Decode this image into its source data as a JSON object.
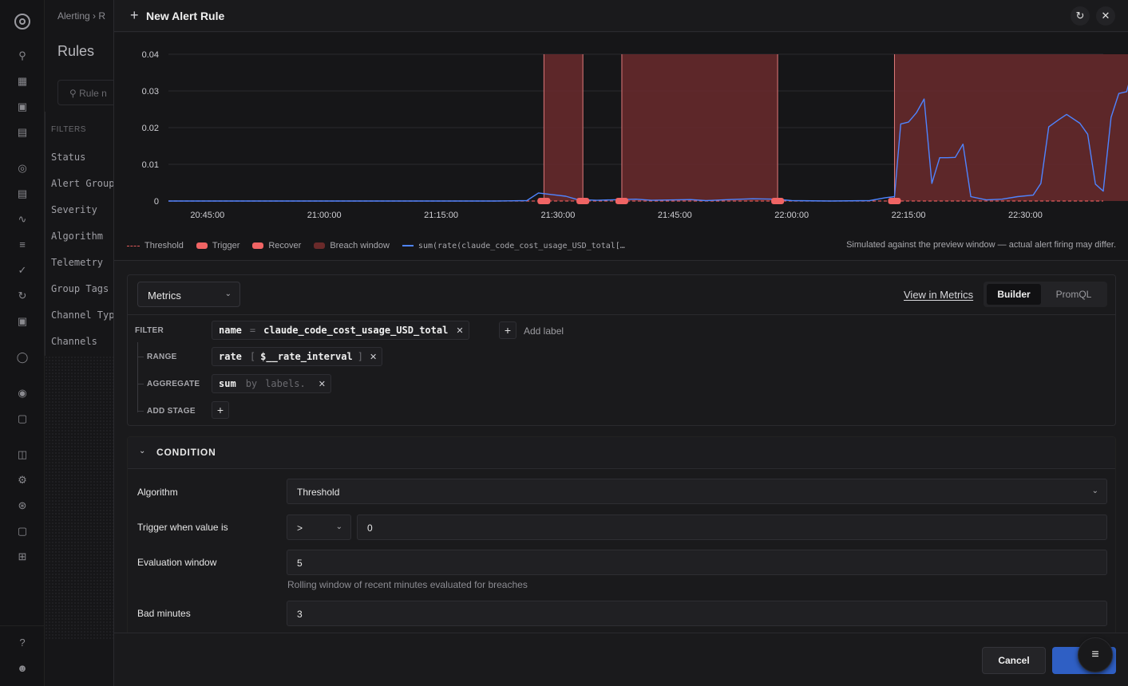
{
  "modal": {
    "title": "New Alert Rule",
    "header_plus": "+",
    "refresh_icon": "refresh-icon",
    "close_icon": "close-icon"
  },
  "background_page": {
    "breadcrumb": "Alerting",
    "title": "Rules",
    "search_placeholder": "Rule n",
    "filters_label": "FILTERS",
    "filters": [
      "Status",
      "Alert Group",
      "Severity",
      "Algorithm",
      "Telemetry",
      "Group Tags",
      "Channel Typ",
      "Channels"
    ]
  },
  "chart_data": {
    "type": "line",
    "title": "",
    "xlabel": "",
    "ylabel": "",
    "x_ticks": [
      "20:45:00",
      "21:00:00",
      "21:15:00",
      "21:30:00",
      "21:45:00",
      "22:00:00",
      "22:15:00",
      "22:30:00"
    ],
    "y_ticks": [
      "0",
      "0.01",
      "0.02",
      "0.03",
      "0.04"
    ],
    "ylim": [
      0,
      0.04
    ],
    "xlim_minutes_after_2030": [
      10,
      130
    ],
    "threshold": 0,
    "breach_windows": [
      [
        58.2,
        63.2
      ],
      [
        68.2,
        88.2
      ],
      [
        103.2,
        137.2
      ]
    ],
    "trigger_markers": [
      58.2,
      68.2,
      103.2
    ],
    "recover_markers": [
      63.2,
      88.2
    ],
    "series": [
      {
        "name": "sum(rate(claude_code_cost_usage_USD_total[…",
        "color": "#4f84ff",
        "points": [
          [
            10,
            0
          ],
          [
            45,
            0
          ],
          [
            52,
            0
          ],
          [
            56,
            0.0001
          ],
          [
            57.5,
            0.0022
          ],
          [
            59,
            0.0018
          ],
          [
            61,
            0.0013
          ],
          [
            62.5,
            0.0004
          ],
          [
            65,
            0.0002
          ],
          [
            68,
            0.0004
          ],
          [
            70,
            0.0005
          ],
          [
            72,
            0.0002
          ],
          [
            75,
            0.0003
          ],
          [
            77,
            0.0004
          ],
          [
            79,
            0.0001
          ],
          [
            82,
            0.0004
          ],
          [
            85,
            0.0006
          ],
          [
            88,
            0.0005
          ],
          [
            90,
            0.0001
          ],
          [
            95,
            0
          ],
          [
            100,
            0.0001
          ],
          [
            102,
            0.0009
          ],
          [
            103.2,
            0.0012
          ],
          [
            104,
            0.021
          ],
          [
            105,
            0.0215
          ],
          [
            106,
            0.024
          ],
          [
            107,
            0.0278
          ],
          [
            108,
            0.0048
          ],
          [
            109,
            0.0118
          ],
          [
            110,
            0.0118
          ],
          [
            111,
            0.0119
          ],
          [
            112,
            0.0155
          ],
          [
            113,
            0.0012
          ],
          [
            115,
            0.0003
          ],
          [
            117,
            0.0005
          ],
          [
            119,
            0.0012
          ],
          [
            121,
            0.0016
          ],
          [
            122,
            0.0048
          ],
          [
            123,
            0.0202
          ],
          [
            124.3,
            0.0222
          ],
          [
            125.3,
            0.0236
          ],
          [
            127,
            0.0212
          ],
          [
            128,
            0.0182
          ],
          [
            129,
            0.0046
          ],
          [
            130,
            0.0027
          ],
          [
            131,
            0.0228
          ],
          [
            132,
            0.0293
          ],
          [
            133,
            0.0298
          ],
          [
            134,
            0.0376
          ],
          [
            135,
            0.0285
          ],
          [
            136,
            0.0025
          ],
          [
            137,
            0.0003
          ],
          [
            138,
            0.0001
          ],
          [
            140,
            0
          ]
        ]
      }
    ]
  },
  "legend": {
    "threshold": "Threshold",
    "trigger": "Trigger",
    "recover": "Recover",
    "breach_window": "Breach window",
    "series": "sum(rate(claude_code_cost_usage_USD_total[…"
  },
  "simulation_note": "Simulated against the preview window — actual alert firing may differ.",
  "query": {
    "datasource": "Metrics",
    "view_in_metrics": "View in Metrics",
    "mode_builder": "Builder",
    "mode_promql": "PromQL",
    "filter_label": "FILTER",
    "filter_key": "name",
    "filter_op": "=",
    "filter_value": "claude_code_cost_usage_USD_total",
    "add_label": "Add label",
    "range_label": "RANGE",
    "range_fn": "rate",
    "range_open": "[",
    "range_value": "$__rate_interval",
    "range_close": "]",
    "aggregate_label": "AGGREGATE",
    "aggregate_fn": "sum",
    "aggregate_by": "by",
    "aggregate_labels_placeholder": "labels.",
    "add_stage_label": "ADD STAGE"
  },
  "condition": {
    "header": "CONDITION",
    "algorithm_label": "Algorithm",
    "algorithm_value": "Threshold",
    "trigger_label": "Trigger when value is",
    "trigger_operator": ">",
    "trigger_value": "0",
    "eval_window_label": "Evaluation window",
    "eval_window_value": "5",
    "eval_window_hint": "Rolling window of recent minutes evaluated for breaches",
    "bad_minutes_label": "Bad minutes",
    "bad_minutes_value": "3"
  },
  "footer": {
    "cancel": "Cancel",
    "create": "Cr"
  }
}
